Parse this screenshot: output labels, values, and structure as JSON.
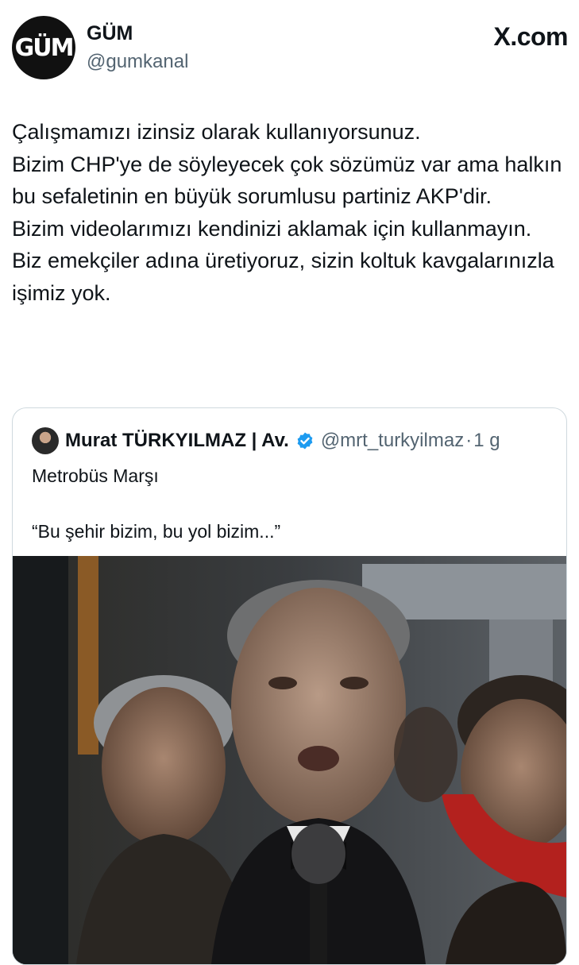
{
  "account": {
    "logo_text": "GÜM",
    "name": "GÜM",
    "handle": "@gumkanal"
  },
  "source_label": "X.com",
  "tweet": {
    "lines": [
      "Çalışmamızı izinsiz olarak kullanıyorsunuz.",
      "Bizim CHP'ye de söyleyecek çok sözümüz var ama halkın bu sefaletinin en büyük sorumlusu partiniz AKP'dir.",
      "Bizim videolarımızı kendinizi aklamak için kullanmayın.",
      "Biz emekçiler adına üretiyoruz, sizin koltuk kavgalarınızla işimiz yok."
    ]
  },
  "quoted": {
    "name": "Murat TÜRKYILMAZ | Av.",
    "verified_icon": "verified-badge-icon",
    "handle": "@mrt_turkyilmaz",
    "separator": "·",
    "time": "1 g",
    "text_line1": "Metrobüs Marşı",
    "text_line2": "“Bu şehir bizim, bu yol bizim...”"
  },
  "colors": {
    "text_primary": "#0f1419",
    "text_secondary": "#536471",
    "border": "#cfd9de",
    "verified": "#1d9bf0"
  }
}
